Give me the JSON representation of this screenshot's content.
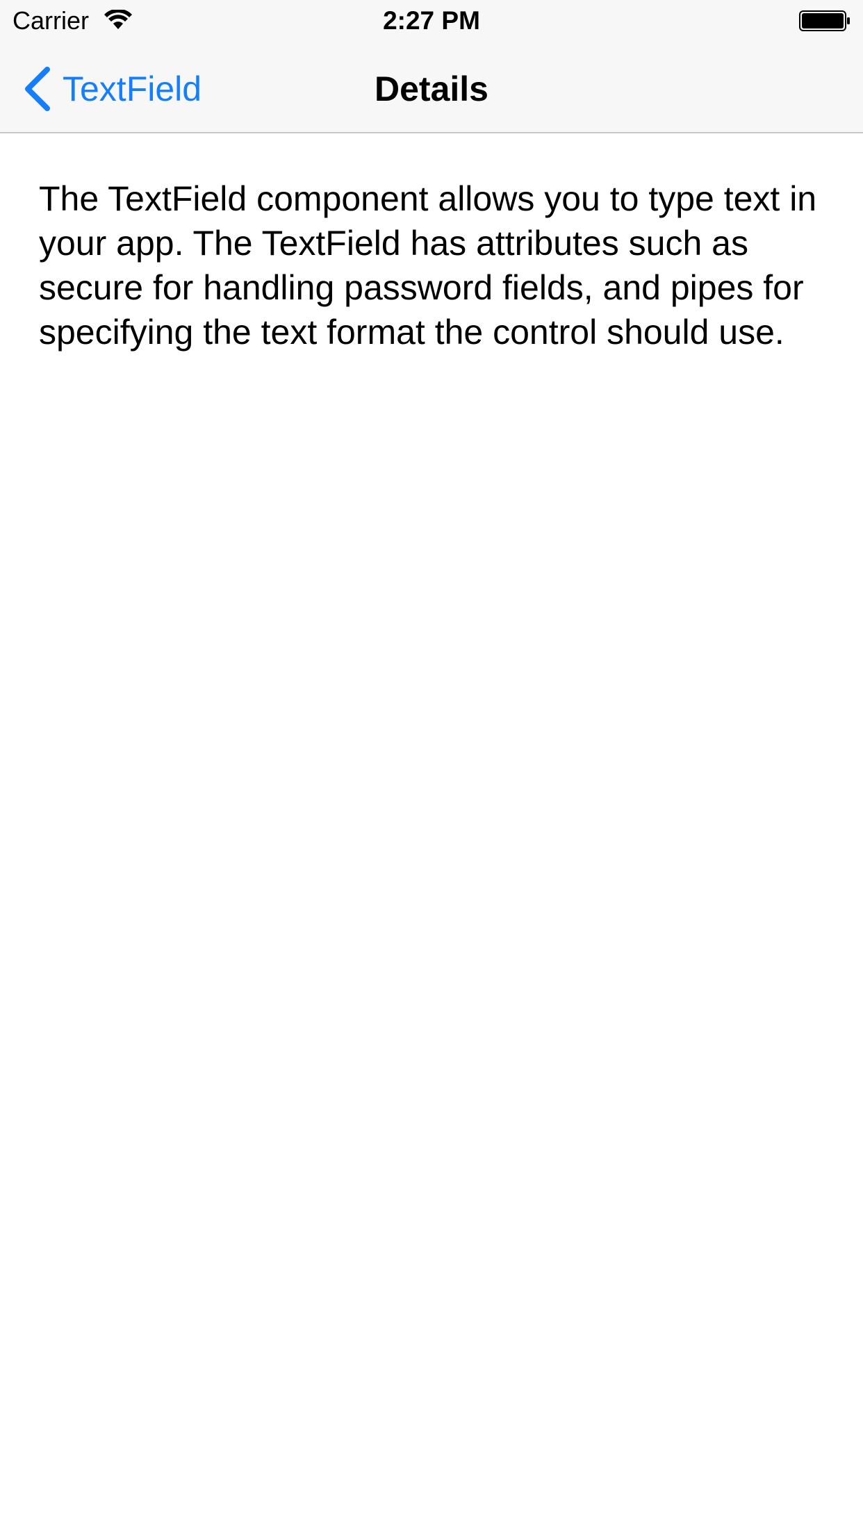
{
  "status_bar": {
    "carrier": "Carrier",
    "time": "2:27 PM",
    "wifi_icon": "wifi-icon",
    "battery_icon": "battery-full-icon"
  },
  "nav_bar": {
    "back_label": "TextField",
    "back_icon": "chevron-left-icon",
    "title": "Details"
  },
  "content": {
    "description": "The TextField component allows you to type text in your app. The TextField has attributes such as secure for handling password fields, and pipes for specifying the text format the control should use."
  },
  "colors": {
    "accent": "#147efb",
    "bar_background": "#f7f7f7",
    "separator": "#c8c7cc",
    "background": "#ffffff",
    "text": "#000000"
  }
}
